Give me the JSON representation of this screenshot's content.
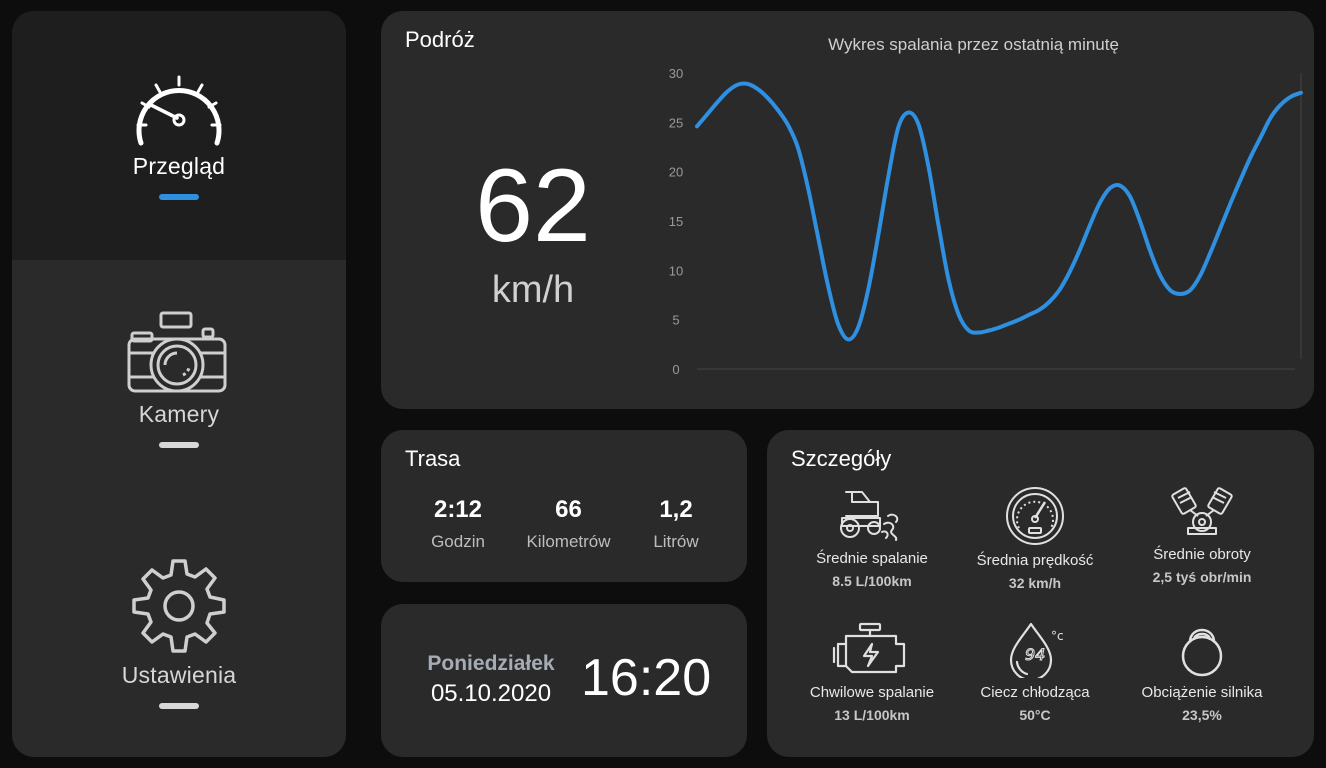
{
  "sidebar": {
    "items": [
      {
        "label": "Przegląd",
        "icon": "speedometer-icon",
        "active": true
      },
      {
        "label": "Kamery",
        "icon": "camera-icon",
        "active": false
      },
      {
        "label": "Ustawienia",
        "icon": "gear-icon",
        "active": false
      }
    ],
    "accent_color": "#2f8fe0"
  },
  "trip": {
    "title": "Podróż",
    "speed": "62",
    "speed_unit": "km/h",
    "chart_title": "Wykres spalania przez ostatnią minutę"
  },
  "route": {
    "title": "Trasa",
    "stats": [
      {
        "value": "2:12",
        "label": "Godzin"
      },
      {
        "value": "66",
        "label": "Kilometrów"
      },
      {
        "value": "1,2",
        "label": "Litrów"
      }
    ]
  },
  "datetime": {
    "day": "Poniedziałek",
    "date": "05.10.2020",
    "time": "16:20"
  },
  "details": {
    "title": "Szczegóły",
    "items": [
      {
        "label": "Średnie spalanie",
        "value": "8.5 L/100km",
        "icon": "car-exhaust-icon"
      },
      {
        "label": "Średnia prędkość",
        "value": "32 km/h",
        "icon": "speedometer-icon"
      },
      {
        "label": "Średnie obroty",
        "value": "2,5 tyś obr/min",
        "icon": "engine-pistons-icon"
      },
      {
        "label": "Chwilowe spalanie",
        "value": "13 L/100km",
        "icon": "engine-icon"
      },
      {
        "label": "Ciecz chłodząca",
        "value": "50°C",
        "icon": "coolant-temperature-icon"
      },
      {
        "label": "Obciążenie silnika",
        "value": "23,5%",
        "icon": "kettlebell-icon"
      }
    ]
  },
  "chart_data": {
    "type": "line",
    "title": "Wykres spalania przez ostatnią minutę",
    "xlabel": "",
    "ylabel": "",
    "ylim": [
      0,
      30
    ],
    "yticks": [
      "0",
      "5",
      "10",
      "15",
      "20",
      "25",
      "30"
    ],
    "x": [
      0,
      1,
      2,
      3,
      4,
      5,
      6,
      7,
      8,
      9,
      10,
      11,
      12,
      13,
      14,
      15,
      16,
      17,
      18,
      19,
      20,
      21,
      22,
      23,
      24,
      25,
      26,
      27,
      28,
      29,
      30,
      31,
      32,
      33,
      34,
      35,
      36,
      37,
      38,
      39,
      40,
      41,
      42,
      43,
      44,
      45,
      46,
      47,
      48,
      49,
      50,
      51,
      52,
      53,
      54,
      55,
      56,
      57,
      58,
      59,
      60
    ],
    "series": [
      {
        "values": [
          24.6,
          25.8,
          27.0,
          28.1,
          28.8,
          28.9,
          28.4,
          27.5,
          26.3,
          24.8,
          22.5,
          18.5,
          13.5,
          8.5,
          4.6,
          3.0,
          4.2,
          8.0,
          13.5,
          19.5,
          24.5,
          26.0,
          24.8,
          20.5,
          14.5,
          9.0,
          5.5,
          3.9,
          3.7,
          3.9,
          4.2,
          4.6,
          5.0,
          5.5,
          6.0,
          6.8,
          8.0,
          9.8,
          12.0,
          14.5,
          16.8,
          18.3,
          18.6,
          17.5,
          15.0,
          12.0,
          9.5,
          8.0,
          7.6,
          8.0,
          9.5,
          11.8,
          14.3,
          16.8,
          19.2,
          21.5,
          23.5,
          25.5,
          26.8,
          27.6,
          28.0
        ]
      }
    ],
    "grid": false,
    "line_color": "#2f8fe0"
  }
}
